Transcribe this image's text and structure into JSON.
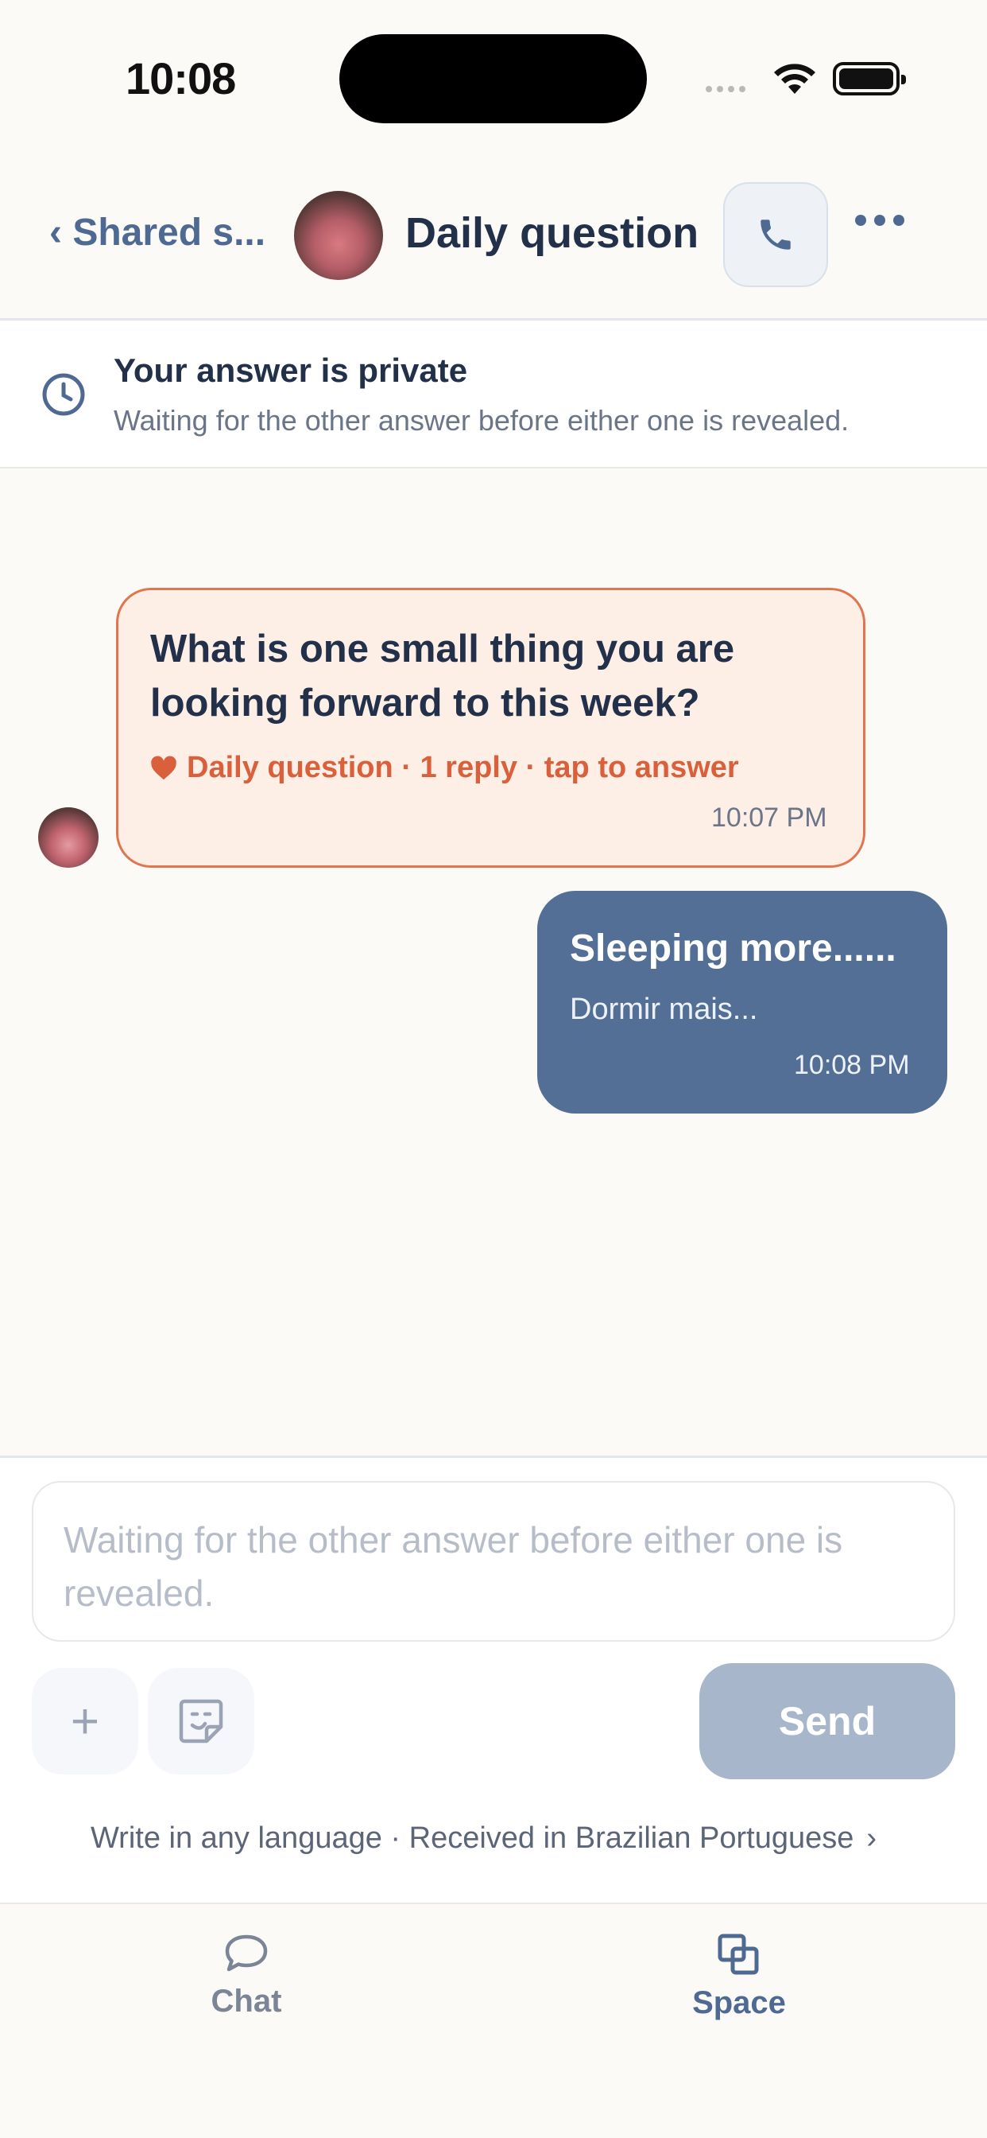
{
  "status_bar": {
    "time": "10:08"
  },
  "header": {
    "back_label": "‹ Shared s...",
    "title": "Daily question"
  },
  "banner": {
    "title": "Your answer is private",
    "subtitle": "Waiting for the other answer before either one is revealed."
  },
  "messages": [
    {
      "question": "What is one small thing you are looking forward to this week?",
      "meta": "Daily question · 1 reply · tap to answer",
      "time": "10:07 PM"
    },
    {
      "text": "Sleeping more......",
      "translation": "Dormir mais...",
      "time": "10:08 PM"
    }
  ],
  "composer": {
    "placeholder": "Waiting for the other answer before either one is revealed.",
    "plus_label": "+",
    "send_label": "Send",
    "language_note": "Write in any language · Received in Brazilian Portuguese",
    "language_chevron": "›"
  },
  "tabs": [
    {
      "label": "Chat",
      "icon": "chat-bubble-icon"
    },
    {
      "label": "Space",
      "icon": "space-squares-icon"
    }
  ],
  "colors": {
    "accent": "#546f96",
    "question_border": "#e07550",
    "question_bg": "#feefe6",
    "send_disabled": "#a7b6ca"
  }
}
